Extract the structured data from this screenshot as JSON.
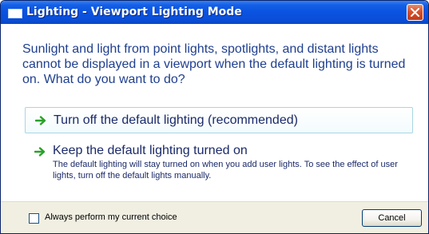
{
  "window": {
    "title": "Lighting - Viewport Lighting Mode"
  },
  "question": "Sunlight and light from point lights, spotlights, and distant lights cannot be displayed in a viewport when the default lighting is turned on. What do you want to do?",
  "options": [
    {
      "title": "Turn off the default lighting (recommended)",
      "description": ""
    },
    {
      "title": "Keep the default lighting turned on",
      "description": "The default lighting will stay turned on when you add user lights. To see the effect of user lights, turn off the default lights manually."
    }
  ],
  "footer": {
    "checkbox_label": "Always perform my current choice",
    "checkbox_checked": false,
    "cancel_label": "Cancel"
  },
  "colors": {
    "titlebar": "#0a52e0",
    "question_text": "#1f3f8f",
    "option_text": "#1a2a6a",
    "arrow": "#2aa12a",
    "close_button": "#d4512e"
  },
  "icons": {
    "app": "window-icon",
    "close": "close-icon",
    "option_arrow": "green-arrow-icon"
  }
}
